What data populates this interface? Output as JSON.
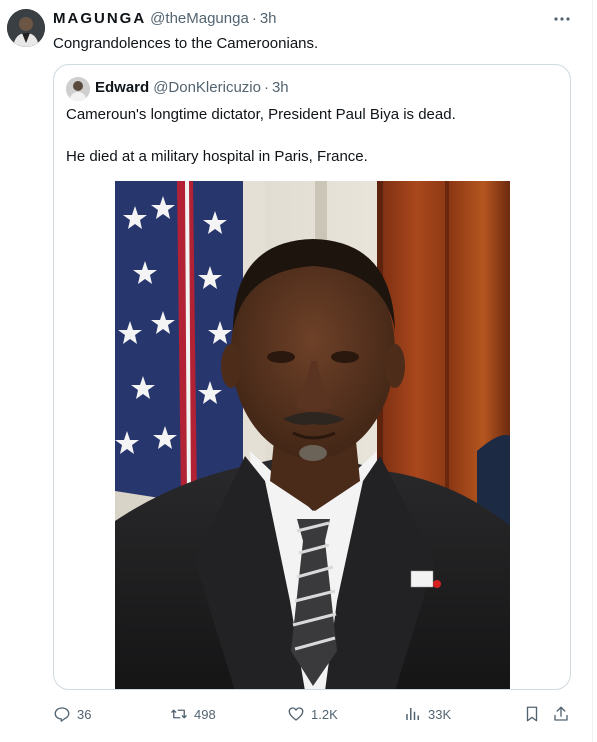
{
  "tweet": {
    "display_name": "MAGUNGA",
    "handle": "@theMagunga",
    "separator": "·",
    "time": "3h",
    "text": "Congrandolences to the Cameroonians."
  },
  "quoted_tweet": {
    "display_name": "Edward",
    "handle": "@DonKlericuzio",
    "separator": "·",
    "time": "3h",
    "line1": "Cameroun's longtime dictator, President Paul Biya is dead.",
    "line2": "He died at a military hospital in Paris, France."
  },
  "actions": {
    "replies": "36",
    "reposts": "498",
    "likes": "1.2K",
    "views": "33K"
  },
  "icons": {
    "more": "more-icon",
    "reply": "reply-icon",
    "repost": "repost-icon",
    "like": "heart-icon",
    "views": "views-icon",
    "bookmark": "bookmark-icon",
    "share": "share-icon"
  },
  "colors": {
    "text": "#0f1419",
    "secondary": "#536471",
    "border": "#cfd9de"
  }
}
